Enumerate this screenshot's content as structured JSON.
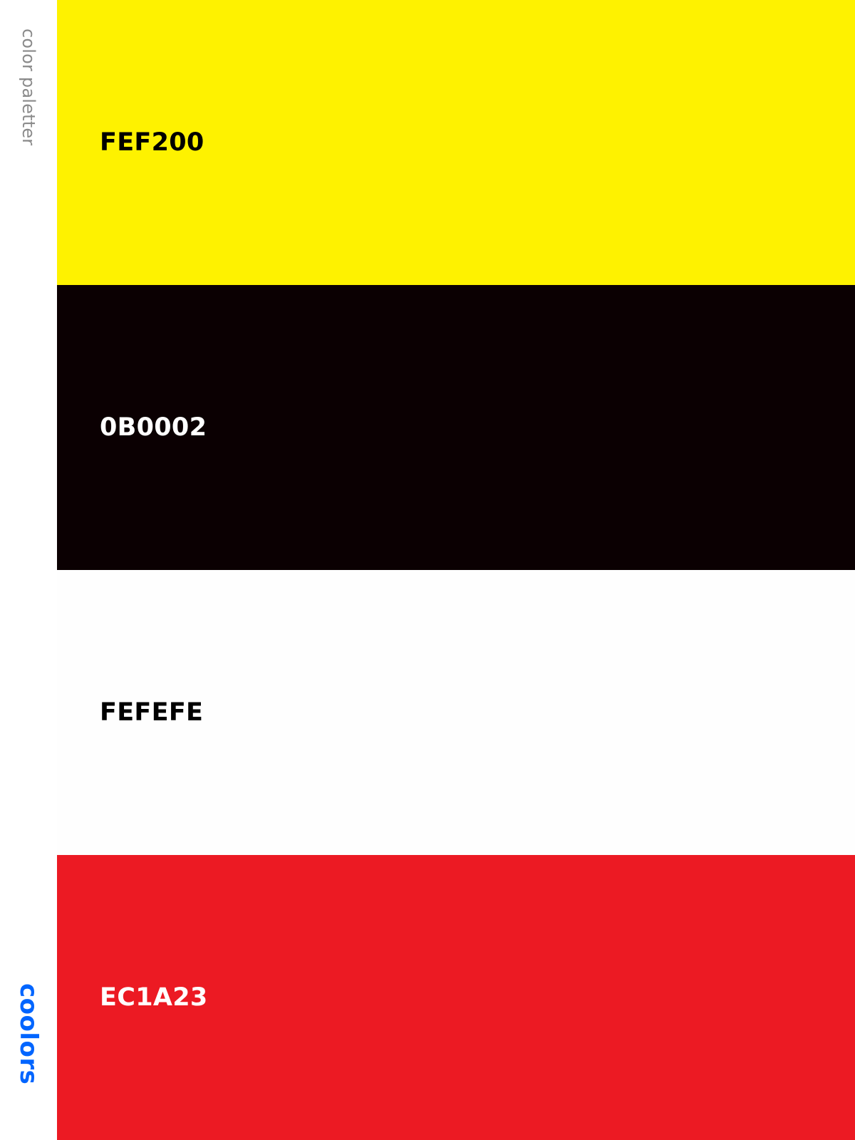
{
  "sidebar": {
    "title": "color paletter",
    "logo": "coolors"
  },
  "palette": {
    "swatches": [
      {
        "hex": "FEF200",
        "background": "#FEF200",
        "text_color": "#000000"
      },
      {
        "hex": "0B0002",
        "background": "#0B0002",
        "text_color": "#FFFFFF"
      },
      {
        "hex": "FEFEFE",
        "background": "#FEFEFE",
        "text_color": "#000000"
      },
      {
        "hex": "EC1A23",
        "background": "#EC1A23",
        "text_color": "#FFFFFF"
      }
    ]
  },
  "colors": {
    "logo": "#0065FF",
    "sidebar_text": "#8A8A8A"
  }
}
